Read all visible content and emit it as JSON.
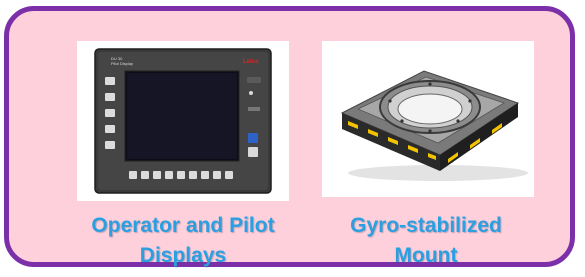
{
  "colors": {
    "panel_background": "#fdd0dc",
    "panel_border": "#7b2fa8",
    "caption_text": "#2aa0e0"
  },
  "products": [
    {
      "id": "display",
      "image_icon": "control-display-unit-image",
      "caption": "Operator and Pilot Displays",
      "caption_line1": "Operator and Pilot",
      "caption_line2": "Displays"
    },
    {
      "id": "mount",
      "image_icon": "gyro-stabilized-mount-image",
      "caption": "Gyro-stabilized Mount",
      "caption_line1": "Gyro-stabilized",
      "caption_line2": "Mount"
    }
  ],
  "display_unit": {
    "brand_logo": "Leica",
    "model_label_line1": "DU 30",
    "model_label_line2": "Pilot Display"
  }
}
